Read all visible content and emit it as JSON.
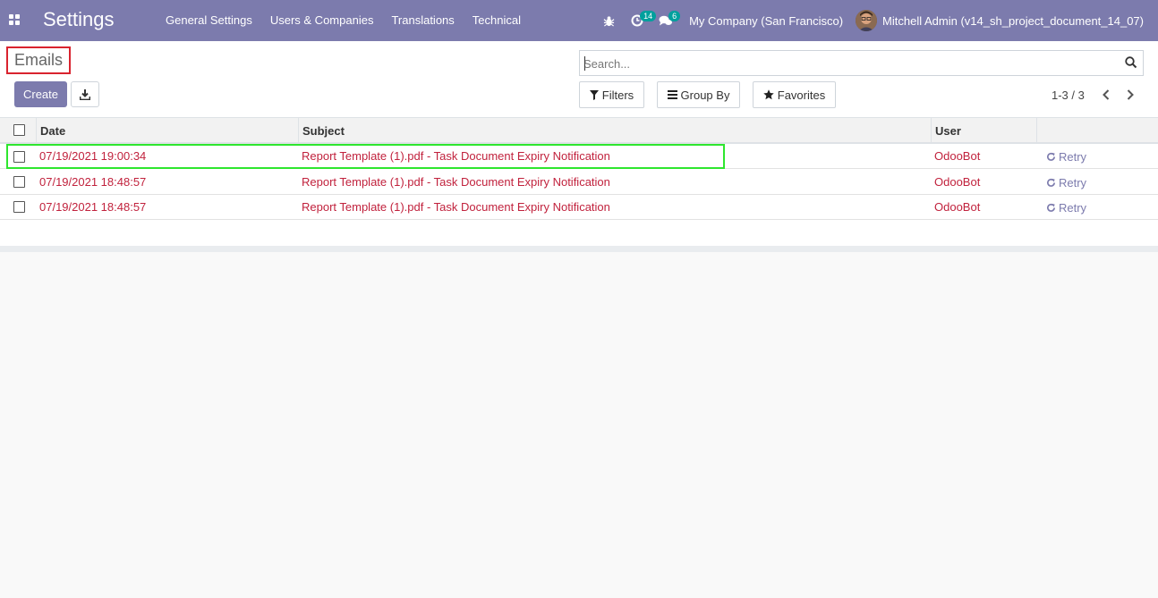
{
  "navbar": {
    "brand": "Settings",
    "menu": [
      {
        "label": "General Settings"
      },
      {
        "label": "Users & Companies"
      },
      {
        "label": "Translations"
      },
      {
        "label": "Technical"
      }
    ],
    "activity_count": "14",
    "messages_count": "6",
    "company": "My Company (San Francisco)",
    "user_name": "Mitchell Admin (v14_sh_project_document_14_07)"
  },
  "control_panel": {
    "breadcrumb": "Emails",
    "create_label": "Create",
    "search_placeholder": "Search...",
    "filters_label": "Filters",
    "group_by_label": "Group By",
    "favorites_label": "Favorites",
    "pager": "1-3 / 3"
  },
  "table": {
    "columns": {
      "date": "Date",
      "subject": "Subject",
      "user": "User"
    },
    "rows": [
      {
        "date": "07/19/2021 19:00:34",
        "subject": "Report Template (1).pdf - Task Document Expiry Notification",
        "user": "OdooBot",
        "action": "Retry"
      },
      {
        "date": "07/19/2021 18:48:57",
        "subject": "Report Template (1).pdf - Task Document Expiry Notification",
        "user": "OdooBot",
        "action": "Retry"
      },
      {
        "date": "07/19/2021 18:48:57",
        "subject": "Report Template (1).pdf - Task Document Expiry Notification",
        "user": "OdooBot",
        "action": "Retry"
      }
    ]
  },
  "colors": {
    "navbar": "#7c7bad",
    "row_text": "#c1223d",
    "breadcrumb_highlight": "#d9232e",
    "row_highlight": "#2ee62e"
  }
}
